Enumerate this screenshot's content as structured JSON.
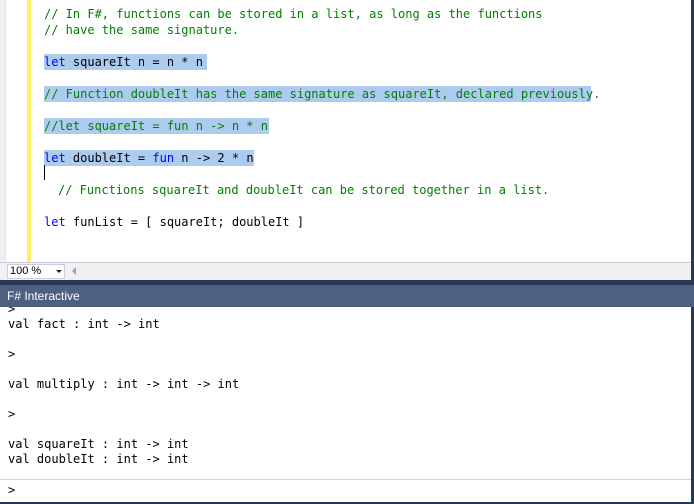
{
  "editor": {
    "lines": [
      {
        "kw": "",
        "text": "// In F#, functions can be stored in a list, as long as the functions"
      },
      {
        "kw": "",
        "text": "// have the same signature."
      },
      {
        "kw": "let",
        "text": " squareIt n = n * n"
      },
      {
        "kw": "",
        "text": "// Function doubleIt has the same signature as squareIt, declared previously."
      },
      {
        "kw": "",
        "text": "//let squareIt = fun n -> n * n"
      },
      {
        "kw": "let",
        "text": " doubleIt = ",
        "kw2": "fun",
        "text2": " n -> 2 * n"
      },
      {
        "kw": "",
        "text": "// Functions squareIt and doubleIt can be stored together in a list."
      },
      {
        "kw": "let",
        "text": " funList = [ squareIt; doubleIt ]"
      }
    ],
    "zoom": "100 %"
  },
  "fsi": {
    "title": "F# Interactive",
    "lines": [
      ">",
      "val fact : int -> int",
      ">",
      "val multiply : int -> int -> int",
      ">",
      "val squareIt : int -> int",
      "val doubleIt : int -> int",
      ">"
    ]
  },
  "colors": {
    "keyword": "#0000ff",
    "comment": "#008000",
    "selection": "#adcbef",
    "chrome": "#293955",
    "tool_window_title": "#4d6082"
  }
}
